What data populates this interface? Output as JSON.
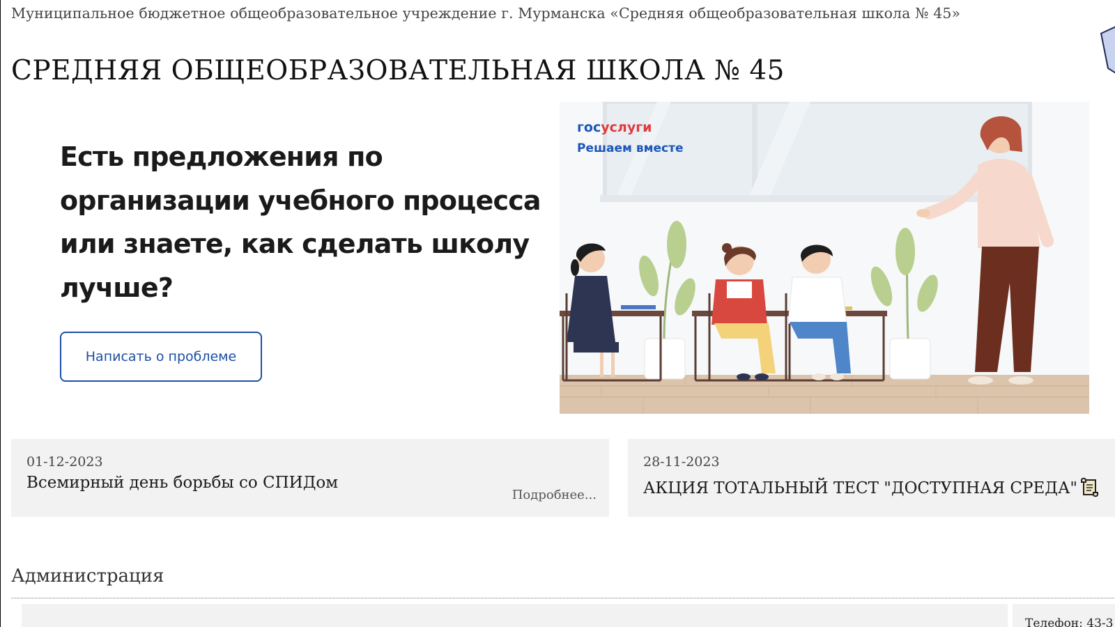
{
  "header": {
    "org_name": "Муниципальное бюджетное общеобразовательное учреждение г. Мурманска «Средняя общеобразовательная школа № 45»",
    "school_title": "СРЕДНЯЯ ОБЩЕОБРАЗОВАТЕЛЬНАЯ ШКОЛА № 45"
  },
  "banner": {
    "question": "Есть предложения по организации учебного процесса или знаете, как сделать школу лучше?",
    "button_label": "Написать о проблеме",
    "logo_gos": "гос",
    "logo_uslugi": "услуги",
    "logo_subtitle": "Решаем вместе"
  },
  "news": [
    {
      "date": "01-12-2023",
      "title": "Всемирный день борьбы со СПИДом",
      "more": "Подробнее..."
    },
    {
      "date": "28-11-2023",
      "title": "АКЦИЯ ТОТАЛЬНЫЙ ТЕСТ \"ДОСТУПНАЯ СРЕДА\""
    }
  ],
  "administration": {
    "heading": "Администрация",
    "phone": "Телефон: 43-3"
  },
  "colors": {
    "accent_blue": "#1b4ea3",
    "gosuslugi_red": "#e03a3e",
    "card_bg": "#f2f2f2"
  }
}
